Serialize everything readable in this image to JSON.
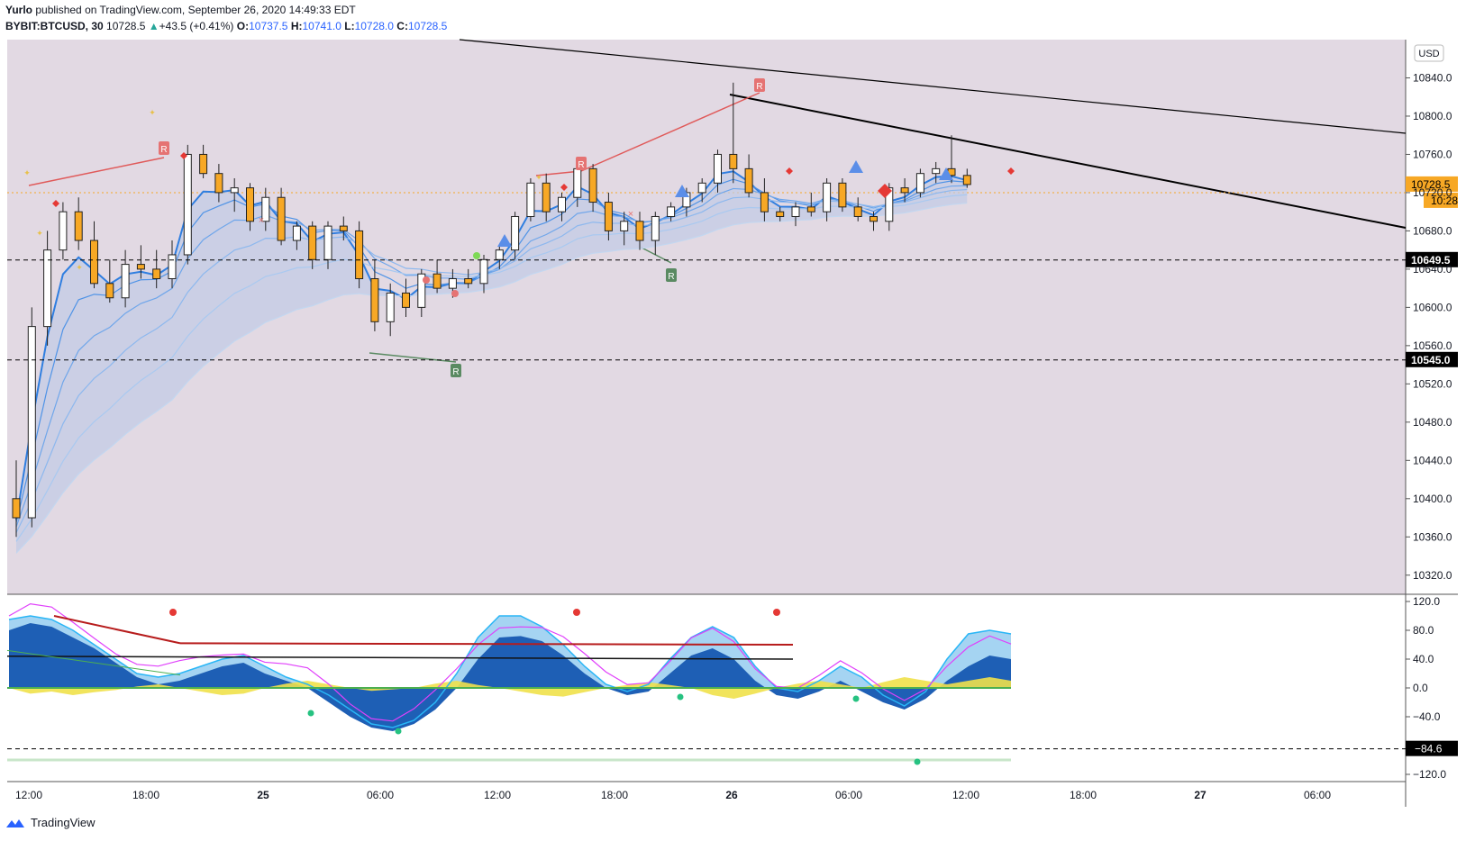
{
  "header": {
    "author": "Yurlo",
    "published_text": "published on TradingView.com, September 26, 2020 14:49:33 EDT",
    "symbol": "BYBIT:BTCUSD",
    "interval": "30",
    "last_price": "10728.5",
    "change": "+43.5 (+0.41%)",
    "open_label": "O:",
    "open": "10737.5",
    "high_label": "H:",
    "high": "10741.0",
    "low_label": "L:",
    "low": "10728.0",
    "close_label": "C:",
    "close": "10728.5"
  },
  "footer": {
    "brand": "TradingView"
  },
  "colors": {
    "panel_bg": "#e2d9e3",
    "up_candle": "#ffffff",
    "down_candle": "#f7a825",
    "ema": "#4a90e2",
    "line_black": "#000000",
    "line_red": "#e05a5a"
  },
  "chart_data": [
    {
      "type": "candlestick",
      "currency": "USD",
      "ylim": [
        10300,
        10880
      ],
      "y_ticks": [
        "10840.0",
        "10800.0",
        "10760.0",
        "10720.0",
        "10680.0",
        "10640.0",
        "10600.0",
        "10560.0",
        "10520.0",
        "10480.0",
        "10440.0",
        "10400.0",
        "10360.0",
        "10320.0"
      ],
      "x_ticks": [
        "12:00",
        "18:00",
        "25",
        "06:00",
        "12:00",
        "18:00",
        "26",
        "06:00",
        "12:00",
        "18:00",
        "27",
        "06:00"
      ],
      "last_price_label": "10728.5",
      "countdown_label": "10:28",
      "horizontal_levels": [
        {
          "value": 10649.5,
          "label": "10649.5"
        },
        {
          "value": 10545.0,
          "label": "10545.0"
        }
      ],
      "candles": [
        [
          10400,
          10440,
          10360,
          10380
        ],
        [
          10380,
          10600,
          10370,
          10580
        ],
        [
          10580,
          10680,
          10560,
          10660
        ],
        [
          10660,
          10710,
          10650,
          10700
        ],
        [
          10700,
          10715,
          10660,
          10670
        ],
        [
          10670,
          10690,
          10620,
          10625
        ],
        [
          10625,
          10650,
          10605,
          10610
        ],
        [
          10610,
          10660,
          10600,
          10645
        ],
        [
          10645,
          10665,
          10630,
          10640
        ],
        [
          10640,
          10660,
          10620,
          10630
        ],
        [
          10630,
          10670,
          10620,
          10655
        ],
        [
          10655,
          10770,
          10645,
          10760
        ],
        [
          10760,
          10770,
          10735,
          10740
        ],
        [
          10740,
          10750,
          10710,
          10720
        ],
        [
          10720,
          10735,
          10700,
          10725
        ],
        [
          10725,
          10730,
          10680,
          10690
        ],
        [
          10690,
          10725,
          10680,
          10715
        ],
        [
          10715,
          10725,
          10665,
          10670
        ],
        [
          10670,
          10690,
          10660,
          10685
        ],
        [
          10685,
          10690,
          10640,
          10650
        ],
        [
          10650,
          10690,
          10640,
          10685
        ],
        [
          10685,
          10695,
          10670,
          10680
        ],
        [
          10680,
          10690,
          10620,
          10630
        ],
        [
          10630,
          10650,
          10575,
          10585
        ],
        [
          10585,
          10625,
          10570,
          10615
        ],
        [
          10615,
          10630,
          10590,
          10600
        ],
        [
          10600,
          10640,
          10590,
          10635
        ],
        [
          10635,
          10650,
          10615,
          10620
        ],
        [
          10620,
          10640,
          10610,
          10630
        ],
        [
          10630,
          10640,
          10620,
          10625
        ],
        [
          10625,
          10655,
          10615,
          10650
        ],
        [
          10650,
          10665,
          10640,
          10660
        ],
        [
          10660,
          10700,
          10650,
          10695
        ],
        [
          10695,
          10735,
          10690,
          10730
        ],
        [
          10730,
          10740,
          10690,
          10700
        ],
        [
          10700,
          10720,
          10690,
          10715
        ],
        [
          10715,
          10755,
          10705,
          10745
        ],
        [
          10745,
          10750,
          10700,
          10710
        ],
        [
          10710,
          10720,
          10670,
          10680
        ],
        [
          10680,
          10700,
          10665,
          10690
        ],
        [
          10690,
          10700,
          10660,
          10670
        ],
        [
          10670,
          10700,
          10655,
          10695
        ],
        [
          10695,
          10710,
          10690,
          10705
        ],
        [
          10705,
          10725,
          10695,
          10720
        ],
        [
          10720,
          10735,
          10710,
          10730
        ],
        [
          10730,
          10765,
          10720,
          10760
        ],
        [
          10760,
          10835,
          10730,
          10745
        ],
        [
          10745,
          10760,
          10715,
          10720
        ],
        [
          10720,
          10735,
          10690,
          10700
        ],
        [
          10700,
          10705,
          10690,
          10695
        ],
        [
          10695,
          10710,
          10685,
          10705
        ],
        [
          10705,
          10720,
          10695,
          10700
        ],
        [
          10700,
          10735,
          10690,
          10730
        ],
        [
          10730,
          10735,
          10700,
          10705
        ],
        [
          10705,
          10715,
          10690,
          10695
        ],
        [
          10695,
          10700,
          10680,
          10690
        ],
        [
          10690,
          10730,
          10680,
          10725
        ],
        [
          10725,
          10735,
          10710,
          10720
        ],
        [
          10720,
          10745,
          10715,
          10740
        ],
        [
          10740,
          10752,
          10730,
          10745
        ],
        [
          10745,
          10780,
          10730,
          10738
        ],
        [
          10738,
          10745,
          10725,
          10728.5
        ]
      ],
      "markers": [
        "R",
        "R",
        "R",
        "R",
        "R"
      ]
    },
    {
      "type": "oscillator",
      "ylim": [
        -130,
        130
      ],
      "y_ticks": [
        "120.0",
        "80.0",
        "40.0",
        "0.0",
        "−40.0",
        "−120.0"
      ],
      "level_label": "−84.6",
      "wave_blue": [
        80,
        90,
        85,
        70,
        55,
        35,
        15,
        5,
        10,
        20,
        30,
        35,
        20,
        10,
        0,
        -20,
        -40,
        -55,
        -60,
        -50,
        -30,
        0,
        40,
        70,
        72,
        65,
        45,
        20,
        0,
        -10,
        -5,
        20,
        45,
        55,
        40,
        10,
        -10,
        -15,
        -5,
        10,
        -5,
        -20,
        -30,
        -15,
        10,
        30,
        45,
        40
      ],
      "wave_light": [
        95,
        100,
        95,
        80,
        60,
        40,
        20,
        15,
        20,
        30,
        40,
        45,
        30,
        15,
        5,
        -10,
        -30,
        -50,
        -55,
        -45,
        -20,
        20,
        70,
        100,
        100,
        85,
        60,
        30,
        5,
        -5,
        5,
        40,
        70,
        85,
        70,
        30,
        0,
        -5,
        10,
        30,
        15,
        -10,
        -25,
        -5,
        40,
        75,
        80,
        75
      ],
      "wave_yellow": [
        0,
        -8,
        -5,
        -10,
        -6,
        -3,
        2,
        5,
        0,
        -5,
        -10,
        -8,
        0,
        6,
        10,
        5,
        0,
        -4,
        -2,
        0,
        6,
        10,
        4,
        0,
        -5,
        -10,
        -12,
        -6,
        0,
        4,
        8,
        4,
        0,
        -10,
        -15,
        -8,
        0,
        6,
        10,
        5,
        0,
        8,
        15,
        10,
        5,
        10,
        15,
        10
      ]
    }
  ]
}
